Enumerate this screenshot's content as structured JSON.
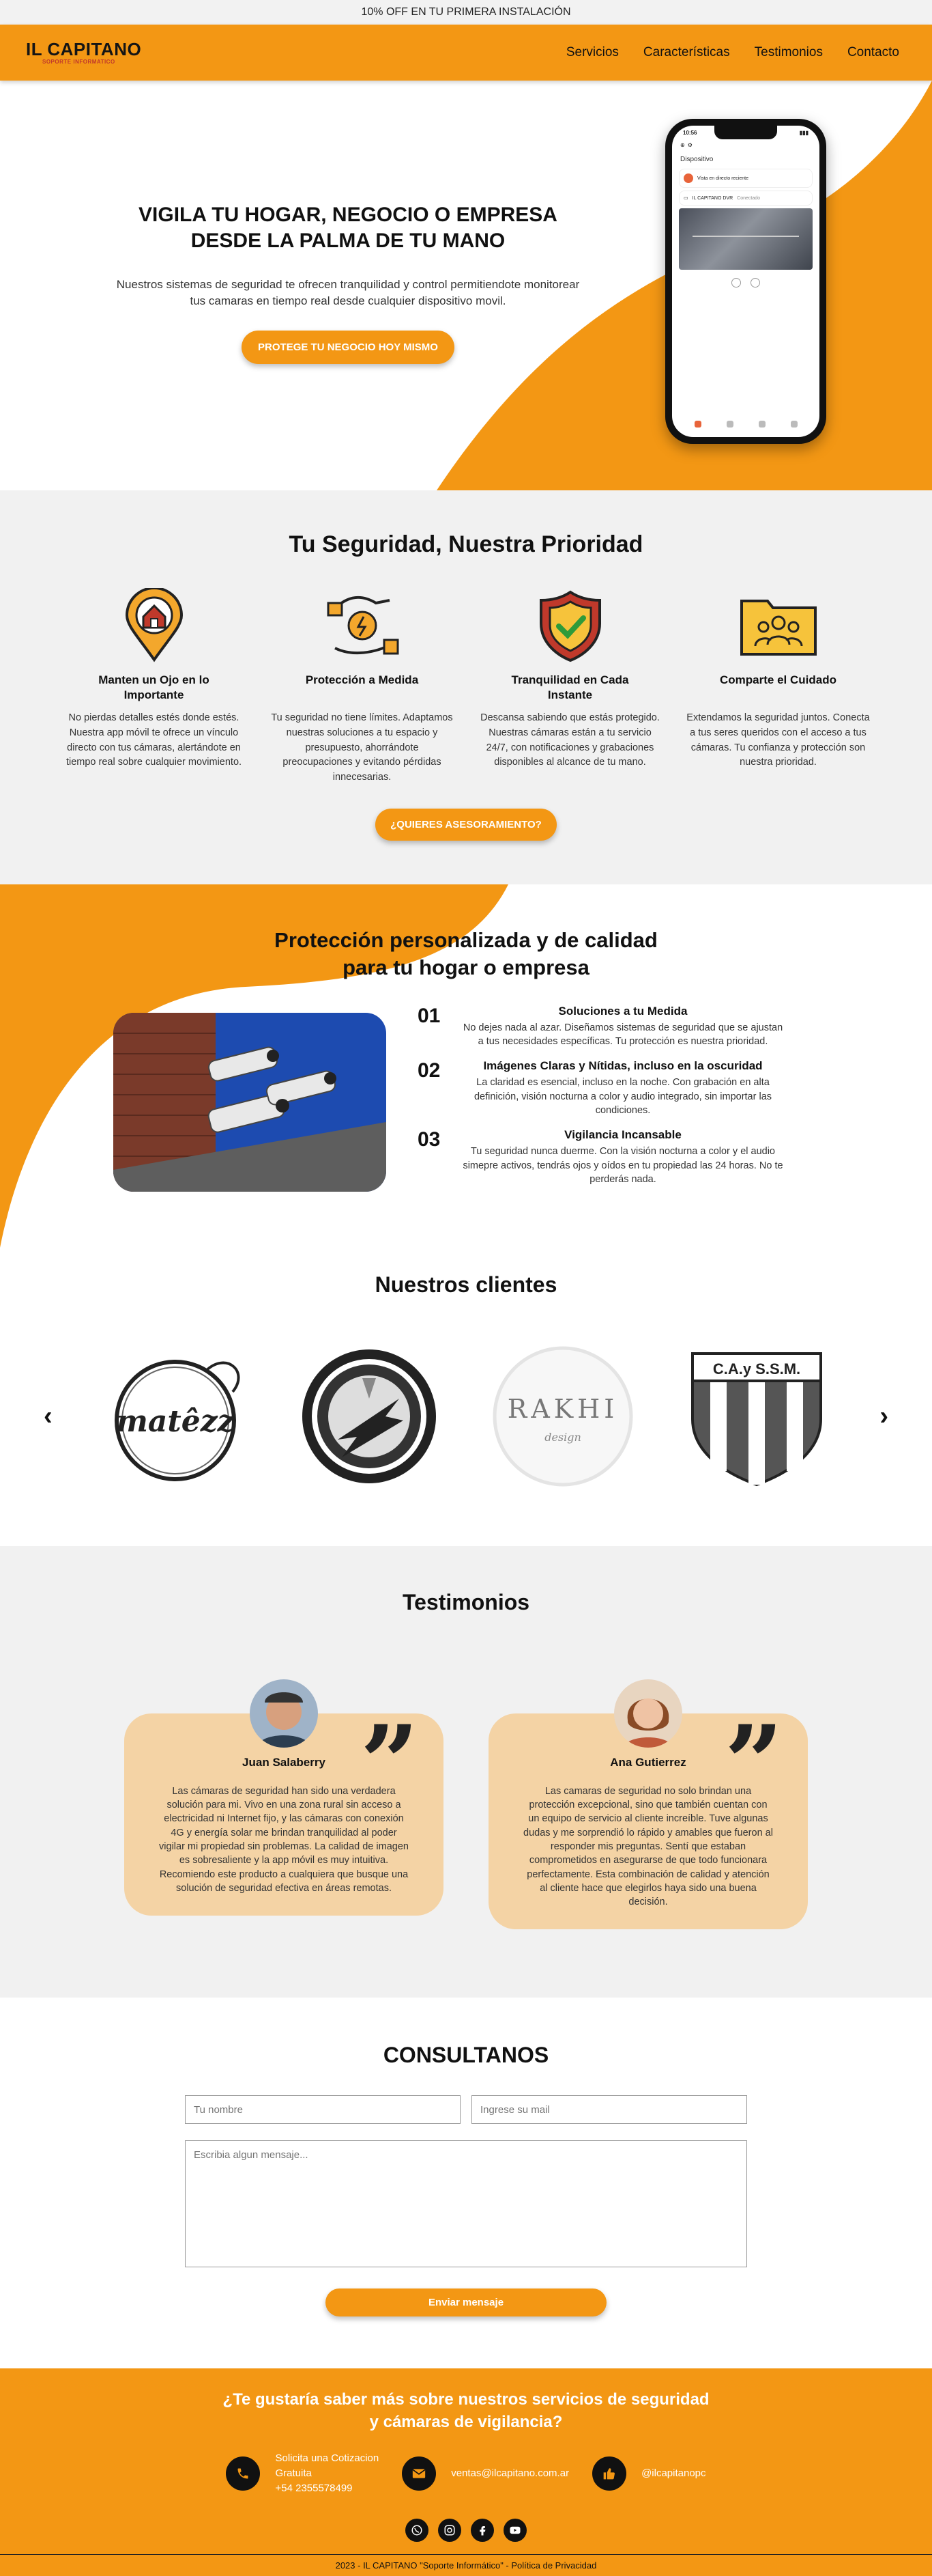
{
  "topbar": {
    "promo": "10% OFF EN TU PRIMERA INSTALACIÓN"
  },
  "header": {
    "logo_main": "IL CAPITANO",
    "logo_sub": "SOPORTE INFORMATICO",
    "nav": [
      "Servicios",
      "Características",
      "Testimonios",
      "Contacto"
    ]
  },
  "hero": {
    "title_line1": "VIGILA TU HOGAR, NEGOCIO O EMPRESA",
    "title_line2": "DESDE LA PALMA DE TU MANO",
    "description": "Nuestros sistemas de seguridad te ofrecen tranquilidad y control permitiendote monitorear tus camaras en tiempo real desde cualquier dispositivo movil.",
    "cta": "PROTEGE TU NEGOCIO HOY MISMO",
    "phone": {
      "time": "10:56",
      "section": "Dispositivo",
      "card1": "Vista en directo reciente",
      "card2": "IL CAPITANO DVR",
      "card2_badge": "Conectado"
    }
  },
  "security": {
    "title": "Tu Seguridad, Nuestra Prioridad",
    "features": [
      {
        "icon": "home-location-icon",
        "title": "Manten un Ojo en lo Importante",
        "desc": "No pierdas detalles estés donde estés. Nuestra app móvil te ofrece un vínculo directo con tus cámaras, alertándote en tiempo real sobre cualquier movimiento."
      },
      {
        "icon": "hand-money-icon",
        "title": "Protección a Medida",
        "desc": "Tu seguridad no tiene límites. Adaptamos nuestras soluciones a tu espacio y presupuesto, ahorrándote preocupaciones y evitando pérdidas innecesarias."
      },
      {
        "icon": "shield-check-icon",
        "title": "Tranquilidad en Cada Instante",
        "desc": "Descansa sabiendo que estás protegido. Nuestras cámaras están a tu servicio 24/7, con notificaciones y grabaciones disponibles al alcance de tu mano."
      },
      {
        "icon": "folder-people-icon",
        "title": "Comparte el Cuidado",
        "desc": "Extendamos la seguridad juntos. Conecta a tus seres queridos con el acceso a tus cámaras. Tu confianza y protección son nuestra prioridad."
      }
    ],
    "cta": "¿QUIERES ASESORAMIENTO?"
  },
  "personal": {
    "title_line1": "Protección personalizada y de calidad",
    "title_line2": "para tu hogar o empresa",
    "steps": [
      {
        "num": "01",
        "title": "Soluciones a tu Medida",
        "desc": "No dejes nada al azar. Diseñamos sistemas de seguridad que se ajustan a tus necesidades específicas. Tu protección es nuestra prioridad."
      },
      {
        "num": "02",
        "title": "Imágenes Claras y Nítidas, incluso en la oscuridad",
        "desc": "La claridad es esencial, incluso en la noche. Con grabación en alta definición, visión nocturna a color y audio integrado, sin importar las condiciones."
      },
      {
        "num": "03",
        "title": "Vigilancia Incansable",
        "desc": "Tu seguridad nunca duerme. Con la visión nocturna a color y el audio simepre activos, tendrás ojos y oídos en tu propiedad las 24 horas. No te perderás nada."
      }
    ]
  },
  "clients": {
    "title": "Nuestros clientes",
    "prev": "‹",
    "next": "›",
    "logos": [
      {
        "name": "matezz",
        "text": "matêzz"
      },
      {
        "name": "gear-lightning",
        "text": ""
      },
      {
        "name": "rakhi",
        "text": "RAKHI",
        "sub": "design"
      },
      {
        "name": "cayssm",
        "text": "C.A.y S.S.M."
      }
    ]
  },
  "testimonials": {
    "title": "Testimonios",
    "items": [
      {
        "name": "Juan Salaberry",
        "text": "Las cámaras de seguridad han sido una verdadera solución para mi. Vivo en una zona rural sin acceso a electricidad ni Internet fijo, y las cámaras con conexión 4G y energía solar me brindan tranquilidad al poder vigilar mi propiedad sin problemas. La calidad de imagen es sobresaliente y la app móvil es muy intuitiva. Recomiendo este producto a cualquiera que busque una solución de seguridad efectiva en áreas remotas."
      },
      {
        "name": "Ana Gutierrez",
        "text": "Las camaras de seguridad no solo brindan una protección excepcional, sino que también cuentan con un equipo de servicio al cliente increíble. Tuve algunas dudas y me sorprendió lo rápido y amables que fueron al responder mis preguntas. Sentí que estaban comprometidos en asegurarse de que todo funcionara perfectamente. Esta combinación de calidad y atención al cliente hace que elegirlos haya sido una buena decisión."
      }
    ]
  },
  "contact": {
    "title": "CONSULTANOS",
    "name_placeholder": "Tu nombre",
    "email_placeholder": "Ingrese su mail",
    "message_placeholder": "Escribia algun mensaje...",
    "submit": "Enviar mensaje"
  },
  "footer": {
    "title_line1": "¿Te gustaría saber más sobre nuestros servicios de seguridad",
    "title_line2": "y cámaras de vigilancia?",
    "phone_line1": "Solicita una Cotizacion",
    "phone_line2": "Gratuita",
    "phone_line3": "+54 2355578499",
    "email": "ventas@ilcapitano.com.ar",
    "social_handle": "@ilcapitanopc",
    "copyright": "2023 - IL CAPITANO \"Soporte Informático\" - Política de Privacidad"
  },
  "colors": {
    "accent": "#f39714",
    "accent_light": "#f4d3a5",
    "section_bg": "#f1f1f1",
    "dark": "#111111"
  }
}
